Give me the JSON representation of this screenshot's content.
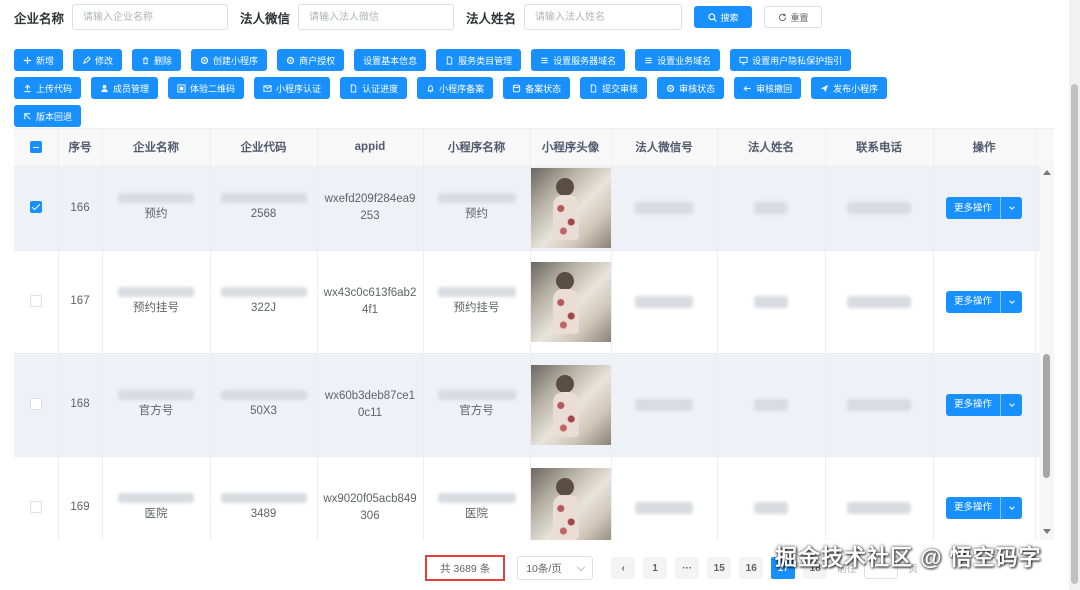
{
  "search": {
    "company_label": "企业名称",
    "company_placeholder": "请输入企业名称",
    "wechat_label": "法人微信",
    "wechat_placeholder": "请输入法人微信",
    "name_label": "法人姓名",
    "name_placeholder": "请输入法人姓名",
    "search_button": "搜索",
    "reset_button": "重置"
  },
  "toolbar": {
    "row1": [
      {
        "label": "新增",
        "icon": "plus-icon",
        "style": "primary"
      },
      {
        "label": "修改",
        "icon": "edit-icon",
        "style": "primary"
      },
      {
        "label": "删除",
        "icon": "trash-icon",
        "style": "primary"
      },
      {
        "label": "创建小程序",
        "icon": "gear-icon",
        "style": "primary"
      },
      {
        "label": "商户授权",
        "icon": "gear-icon",
        "style": "primary"
      },
      {
        "label": "设置基本信息",
        "icon": "",
        "style": "primary"
      },
      {
        "label": "服务类目管理",
        "icon": "doc-icon",
        "style": "primary"
      },
      {
        "label": "设置服务器域名",
        "icon": "menu-icon",
        "style": "primary"
      },
      {
        "label": "设置业务域名",
        "icon": "menu-icon",
        "style": "primary"
      },
      {
        "label": "设置用户隐私保护指引",
        "icon": "monitor-icon",
        "style": "primary"
      }
    ],
    "row2": [
      {
        "label": "上传代码",
        "icon": "upload-icon",
        "style": "primary"
      },
      {
        "label": "成员管理",
        "icon": "user-icon",
        "style": "primary"
      },
      {
        "label": "体验二维码",
        "icon": "qrcode-icon",
        "style": "primary"
      },
      {
        "label": "小程序认证",
        "icon": "mail-icon",
        "style": "primary"
      },
      {
        "label": "认证进度",
        "icon": "doc-icon",
        "style": "primary"
      },
      {
        "label": "小程序备案",
        "icon": "bell-icon",
        "style": "primary"
      },
      {
        "label": "备案状态",
        "icon": "database-icon",
        "style": "primary"
      },
      {
        "label": "提交审核",
        "icon": "doc-icon",
        "style": "primary"
      },
      {
        "label": "审核状态",
        "icon": "gear-icon",
        "style": "primary"
      },
      {
        "label": "审核撤回",
        "icon": "arrow-left-icon",
        "style": "primary"
      },
      {
        "label": "发布小程序",
        "icon": "send-icon",
        "style": "primary"
      }
    ],
    "row3": [
      {
        "label": "版本回退",
        "icon": "arrow-back-icon",
        "style": "primary"
      }
    ]
  },
  "table": {
    "headers": [
      "序号",
      "企业名称",
      "企业代码",
      "appid",
      "小程序名称",
      "小程序头像",
      "法人微信号",
      "法人姓名",
      "联系电话",
      "操作"
    ],
    "rows": [
      {
        "checked": true,
        "index": "166",
        "company_suffix": "预约",
        "code": "2568",
        "appid_line1": "wxefd209f284ea9",
        "appid_line2": "253",
        "app_name_suffix": "预约",
        "action": "更多操作"
      },
      {
        "checked": false,
        "index": "167",
        "company_suffix": "预约挂号",
        "code": "322J",
        "appid_line1": "wx43c0c613f6ab2",
        "appid_line2": "4f1",
        "app_name_suffix": "预约挂号",
        "action": "更多操作"
      },
      {
        "checked": false,
        "index": "168",
        "company_suffix": "官方号",
        "code": "50X3",
        "appid_line1": "wx60b3deb87ce1",
        "appid_line2": "0c11",
        "app_name_suffix": "官方号",
        "action": "更多操作"
      },
      {
        "checked": false,
        "index": "169",
        "company_suffix": "医院",
        "code": "3489",
        "appid_line1": "wx9020f05acb849",
        "appid_line2": "306",
        "app_name_suffix": "医院",
        "action": "更多操作"
      }
    ]
  },
  "pagination": {
    "total": "共 3689 条",
    "page_size": "10条/页",
    "prev": "‹",
    "pages": [
      "1",
      "···",
      "15",
      "16",
      "17",
      "18"
    ],
    "active_page": "17",
    "goto_label": "前往",
    "goto_suffix": "页"
  },
  "watermark": "掘金技术社区 @ 悟空码字",
  "colors": {
    "primary": "#1890ff",
    "highlight_border": "#e0413f",
    "stripe": "#eef1f6"
  }
}
